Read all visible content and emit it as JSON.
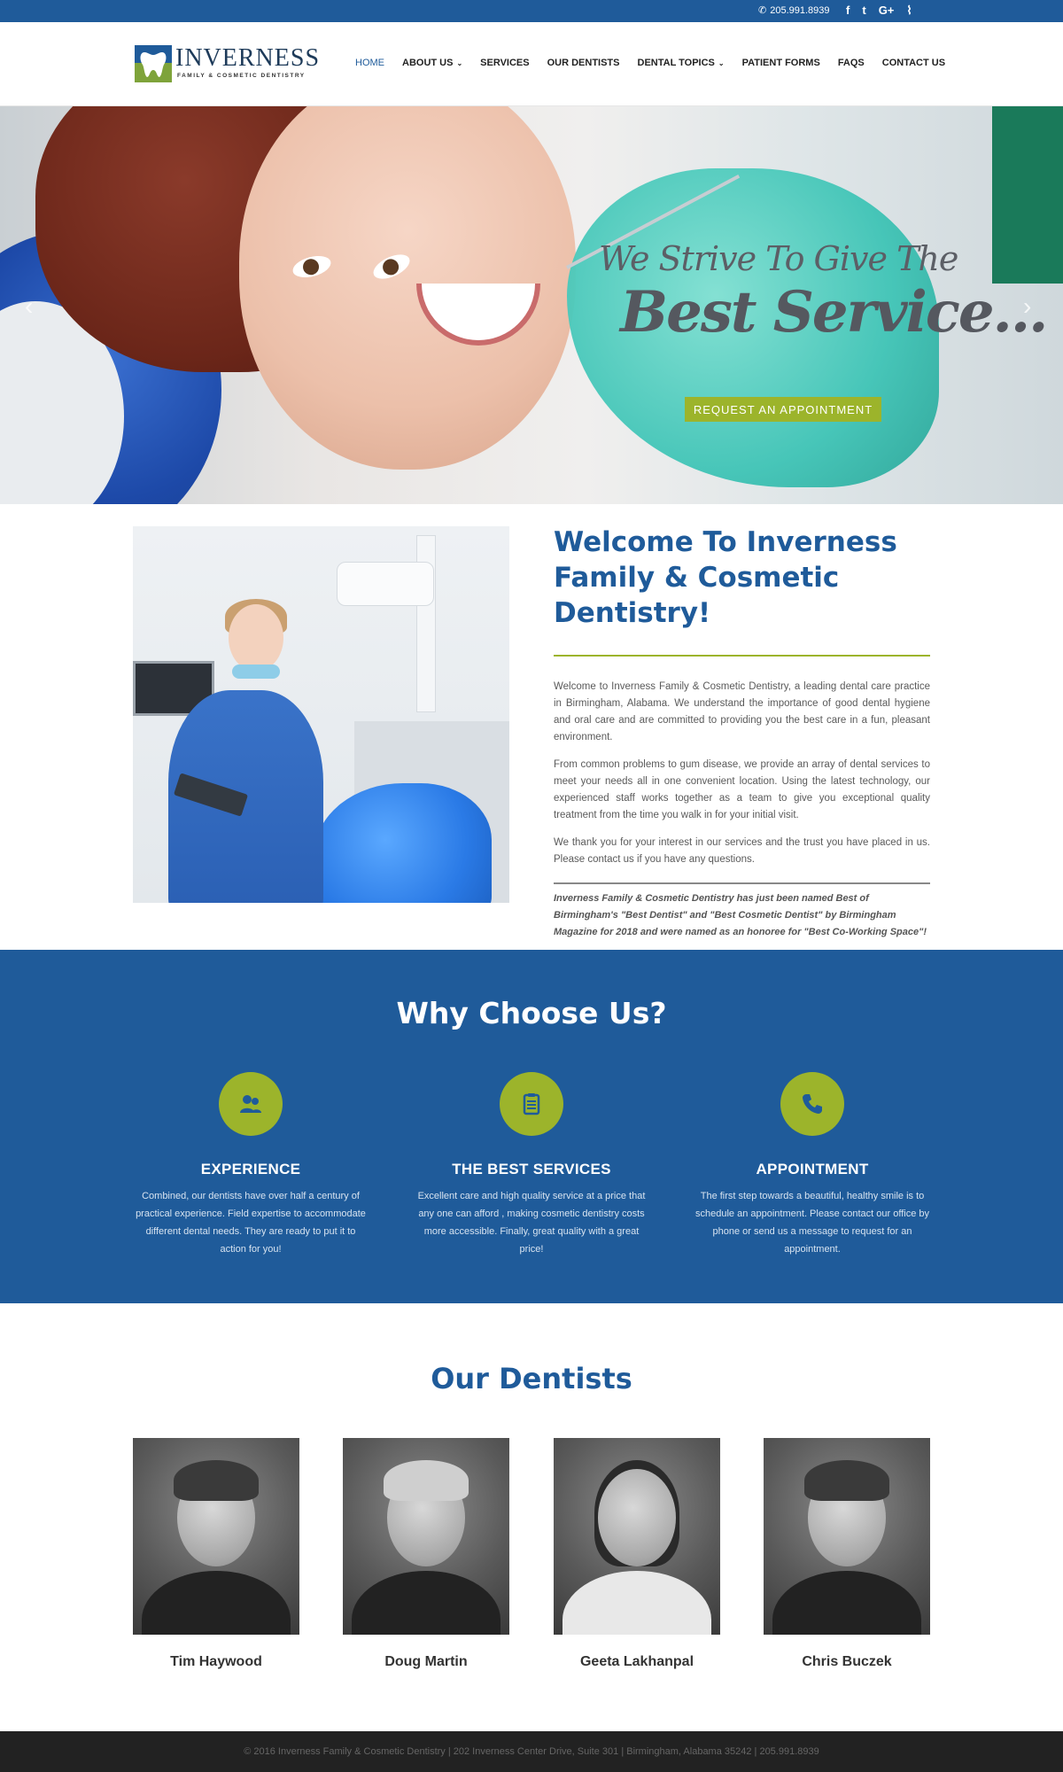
{
  "topbar": {
    "phone": "205.991.8939",
    "social": [
      {
        "icon": "facebook-icon",
        "glyph": "f"
      },
      {
        "icon": "twitter-icon",
        "glyph": "t"
      },
      {
        "icon": "google-plus-icon",
        "glyph": "G+"
      },
      {
        "icon": "rss-icon",
        "glyph": "⌇"
      }
    ]
  },
  "logo": {
    "name": "INVERNESS",
    "tagline": "FAMILY & COSMETIC DENTISTRY"
  },
  "nav": {
    "items": [
      {
        "label": "HOME",
        "active": true,
        "dropdown": false
      },
      {
        "label": "ABOUT US",
        "active": false,
        "dropdown": true
      },
      {
        "label": "SERVICES",
        "active": false,
        "dropdown": false
      },
      {
        "label": "OUR DENTISTS",
        "active": false,
        "dropdown": false
      },
      {
        "label": "DENTAL TOPICS",
        "active": false,
        "dropdown": true
      },
      {
        "label": "PATIENT FORMS",
        "active": false,
        "dropdown": false
      },
      {
        "label": "FAQS",
        "active": false,
        "dropdown": false
      },
      {
        "label": "CONTACT US",
        "active": false,
        "dropdown": false
      }
    ]
  },
  "hero": {
    "headline_line1": "We Strive To Give The",
    "headline_line2": "Best Service...",
    "cta_label": "REQUEST AN APPOINTMENT",
    "prev_arrow": "‹",
    "next_arrow": "›"
  },
  "welcome": {
    "title": "Welcome To Inverness Family & Cosmetic Dentistry!",
    "paragraphs": [
      "Welcome to Inverness Family & Cosmetic Dentistry, a leading dental care practice in Birmingham, Alabama.  We understand the importance of good dental hygiene and oral care and are committed to providing you the best care in a fun, pleasant environment.",
      "From common problems to gum disease, we provide an array of dental services to meet your needs all in one convenient location.  Using the latest technology, our experienced staff works together as a team to give you exceptional quality treatment from the time you walk in for your initial visit.",
      "We thank you for your interest in our services and the trust you have placed in us.  Please contact us if you have any questions."
    ],
    "award": "Inverness Family & Cosmetic Dentistry has just been named Best of Birmingham's \"Best Dentist\" and \"Best Cosmetic Dentist\" by Birmingham Magazine for 2018 and were named as an honoree for \"Best Co-Working Space\"!"
  },
  "why": {
    "title": "Why Choose Us?",
    "features": [
      {
        "icon": "users-icon",
        "glyph": "👥",
        "title": "EXPERIENCE",
        "text": "Combined, our dentists have over half a century of practical experience. Field expertise to accommodate different dental needs. They are ready to put it to action for you!"
      },
      {
        "icon": "clipboard-icon",
        "glyph": "📋",
        "title": "THE BEST SERVICES",
        "text": "Excellent care and high quality service at a price that any one can afford , making cosmetic dentistry costs more accessible. Finally, great quality with a great price!"
      },
      {
        "icon": "phone-icon",
        "glyph": "✆",
        "title": "APPOINTMENT",
        "text": "The first step towards a beautiful, healthy smile is to schedule an appointment. Please contact our office by phone or send us a message to request for an appointment."
      }
    ]
  },
  "dentists": {
    "title": "Our Dentists",
    "people": [
      {
        "name": "Tim Haywood"
      },
      {
        "name": "Doug Martin"
      },
      {
        "name": "Geeta Lakhanpal"
      },
      {
        "name": "Chris Buczek"
      }
    ]
  },
  "footer": {
    "text": "© 2016 Inverness Family & Cosmetic Dentistry | 202 Inverness Center Drive, Suite 301 | Birmingham, Alabama 35242 | 205.991.8939"
  },
  "colors": {
    "brand_blue": "#1f5b9a",
    "accent_green": "#9cb42b",
    "footer_dark": "#222222"
  }
}
